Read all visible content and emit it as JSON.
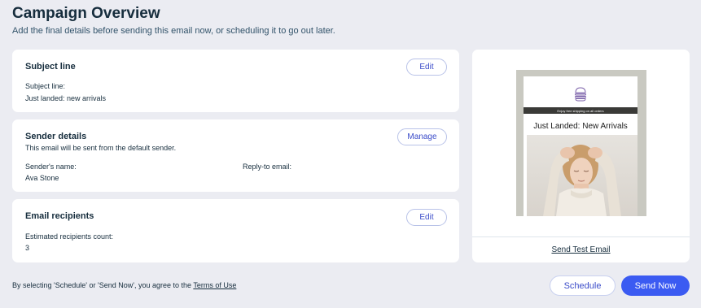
{
  "header": {
    "title": "Campaign Overview",
    "subtitle": "Add the final details before sending this email now, or scheduling it to go out later."
  },
  "subject_card": {
    "title": "Subject line",
    "edit_label": "Edit",
    "field_label": "Subject line:",
    "field_value": "Just landed: new arrivals"
  },
  "sender_card": {
    "title": "Sender details",
    "manage_label": "Manage",
    "description": "This email will be sent from the default sender.",
    "name_label": "Sender's name:",
    "name_value": "Ava Stone",
    "reply_label": "Reply-to email:"
  },
  "recipients_card": {
    "title": "Email recipients",
    "edit_label": "Edit",
    "count_label": "Estimated recipients count:",
    "count_value": "3"
  },
  "preview": {
    "banner_text": "Enjoy free shipping on all orders",
    "heading": "Just Landed: New Arrivals",
    "send_test_label": "Send Test Email",
    "logo_icon": "burger-icon"
  },
  "footer": {
    "consent_text": "By selecting 'Schedule' or 'Send Now', you agree to the ",
    "terms_link": "Terms of Use",
    "schedule_label": "Schedule",
    "send_now_label": "Send Now"
  },
  "colors": {
    "background": "#ebecf2",
    "accent": "#3b5bf2",
    "text": "#162d3d"
  }
}
